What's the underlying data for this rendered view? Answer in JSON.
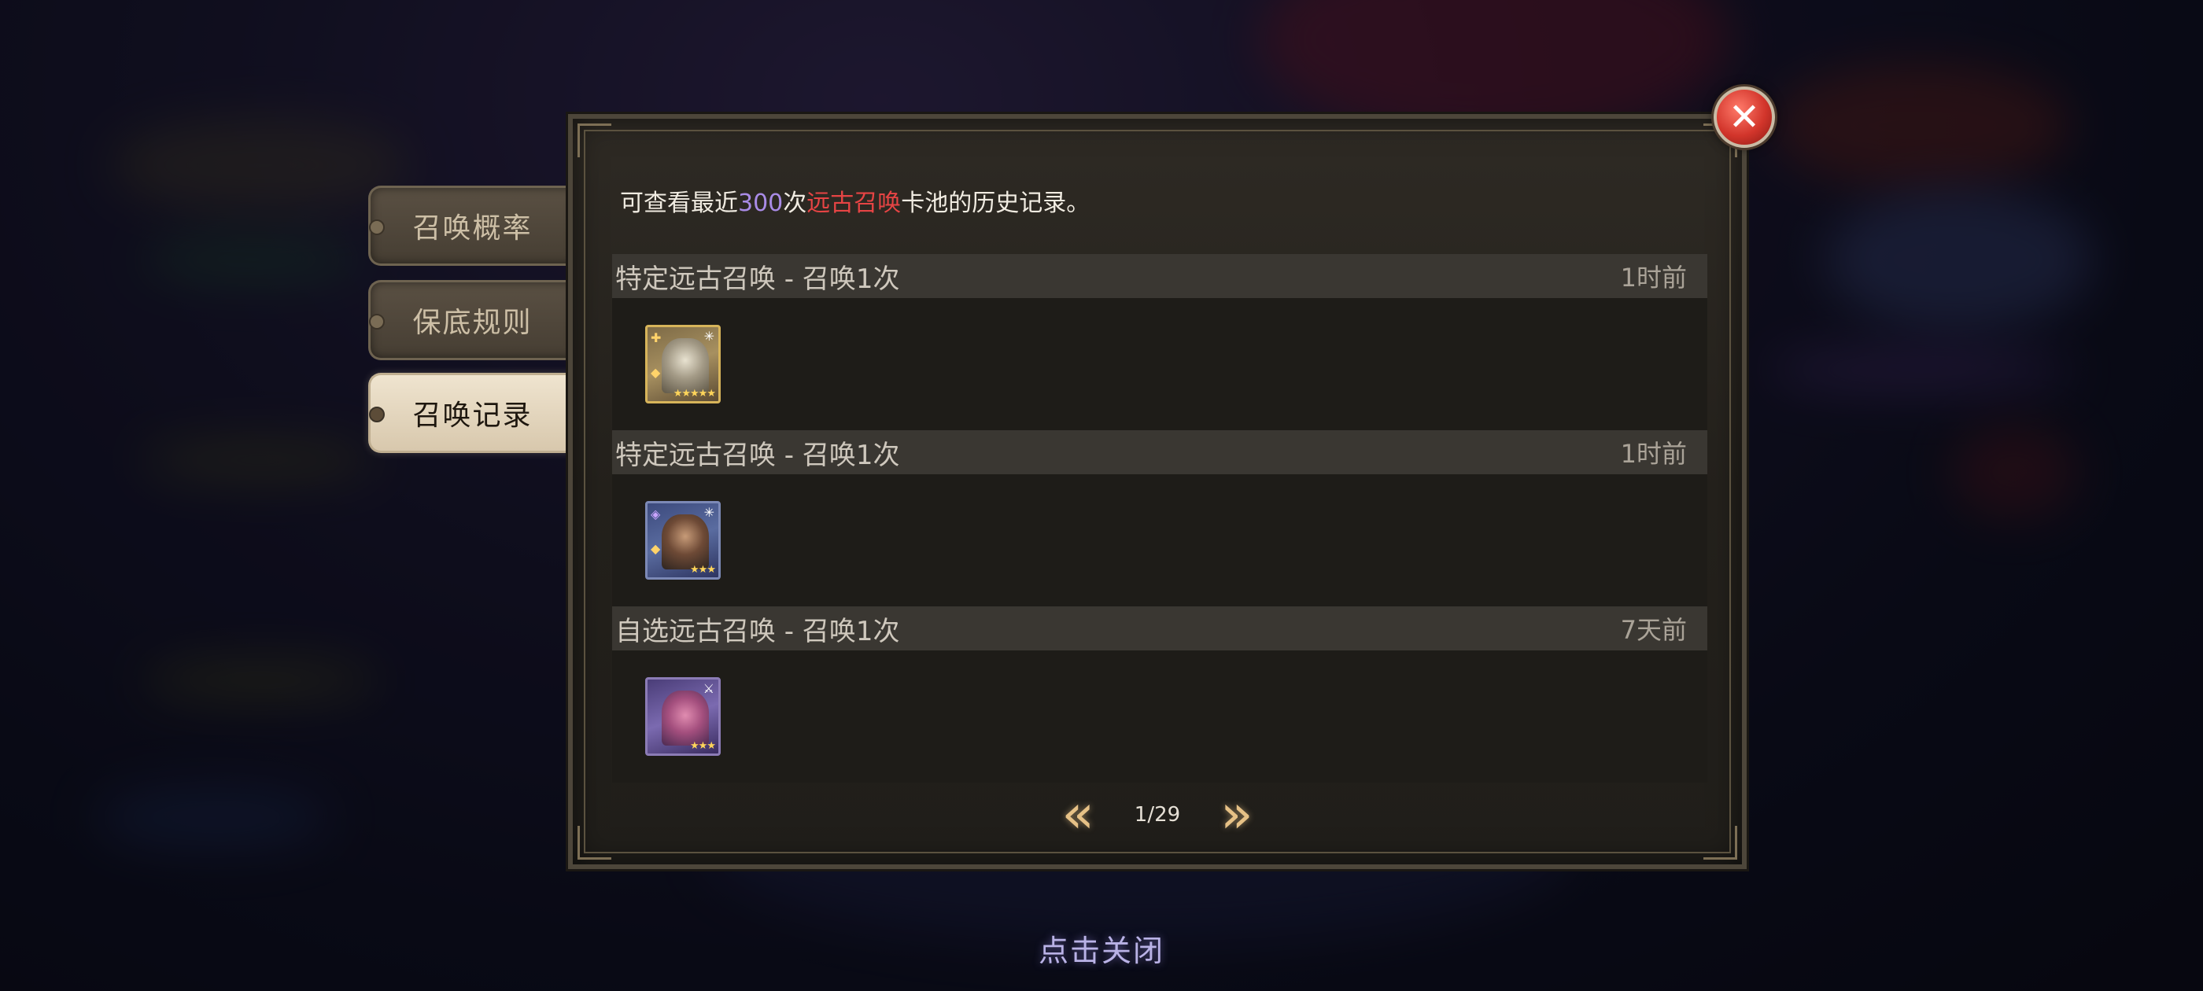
{
  "tabs": [
    {
      "label": "召唤概率",
      "active": false
    },
    {
      "label": "保底规则",
      "active": false
    },
    {
      "label": "召唤记录",
      "active": true
    }
  ],
  "intro": {
    "prefix": "可查看最近",
    "count": "300",
    "count_suffix": "次",
    "pool": "远古召唤",
    "suffix": "卡池的历史记录。"
  },
  "records": [
    {
      "title": "特定远古召唤 - 召唤1次",
      "time": "1时前",
      "card": {
        "frame": "gold",
        "stars": "★★★★★",
        "icon": "hero-elder-mage-icon"
      }
    },
    {
      "title": "特定远古召唤 - 召唤1次",
      "time": "1时前",
      "card": {
        "frame": "blue",
        "stars": "★★★",
        "icon": "hero-warrior-icon"
      }
    },
    {
      "title": "自选远古召唤 - 召唤1次",
      "time": "7天前",
      "card": {
        "frame": "purple",
        "stars": "★★★",
        "icon": "hero-dragon-icon"
      }
    }
  ],
  "pager": {
    "current": "1/29",
    "prev_icon": "double-chevron-left-icon",
    "next_icon": "double-chevron-right-icon"
  },
  "tap_to_close": "点击关闭",
  "colors": {
    "highlight_purple": "#a98be6",
    "highlight_red": "#e64444",
    "close_red": "#d2352b"
  }
}
